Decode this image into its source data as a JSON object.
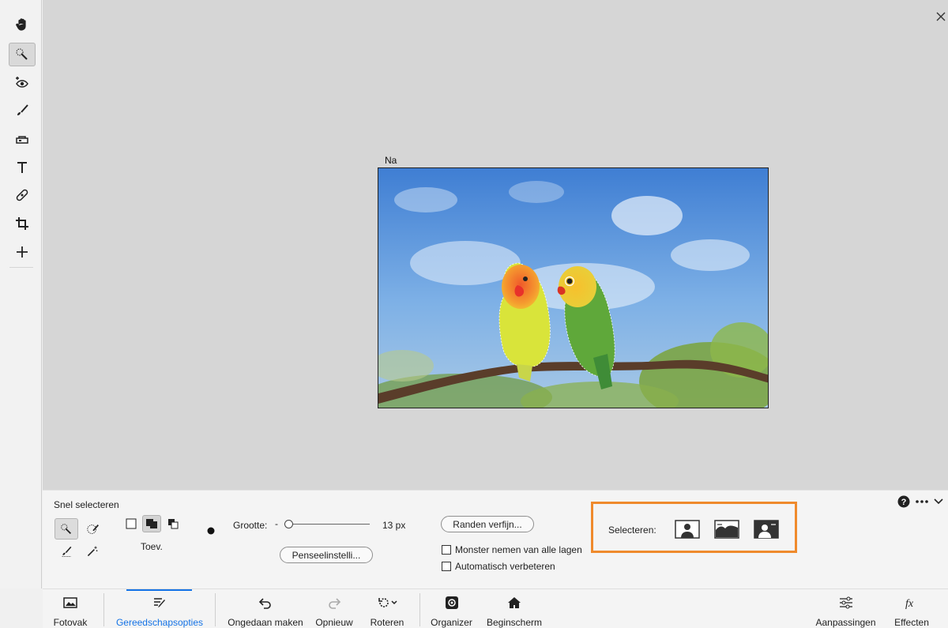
{
  "canvas": {
    "image_label": "Na"
  },
  "tool_options": {
    "title": "Snel selecteren",
    "mode_label": "Toev.",
    "size_label": "Grootte:",
    "size_value": "13 px",
    "size_fraction": 0.05,
    "refine_button": "Randen verfijn...",
    "brush_settings_button": "Penseelinstelli...",
    "sample_all_layers": "Monster nemen van alle lagen",
    "auto_enhance": "Automatisch verbeteren",
    "select_label": "Selecteren:",
    "highlight_color": "#ef8a2c"
  },
  "bottom_bar": {
    "items": [
      {
        "label": "Fotovak",
        "icon": "photo-bin-icon"
      },
      {
        "label": "Gereedschapsopties",
        "icon": "tool-options-icon"
      },
      {
        "label": "Ongedaan maken",
        "icon": "undo-icon"
      },
      {
        "label": "Opnieuw",
        "icon": "redo-icon"
      },
      {
        "label": "Roteren",
        "icon": "rotate-icon"
      },
      {
        "label": "Organizer",
        "icon": "organizer-icon"
      },
      {
        "label": "Beginscherm",
        "icon": "home-icon"
      },
      {
        "label": "Aanpassingen",
        "icon": "adjustments-icon"
      },
      {
        "label": "Effecten",
        "icon": "fx-icon"
      }
    ],
    "active_color": "#1473e6"
  }
}
